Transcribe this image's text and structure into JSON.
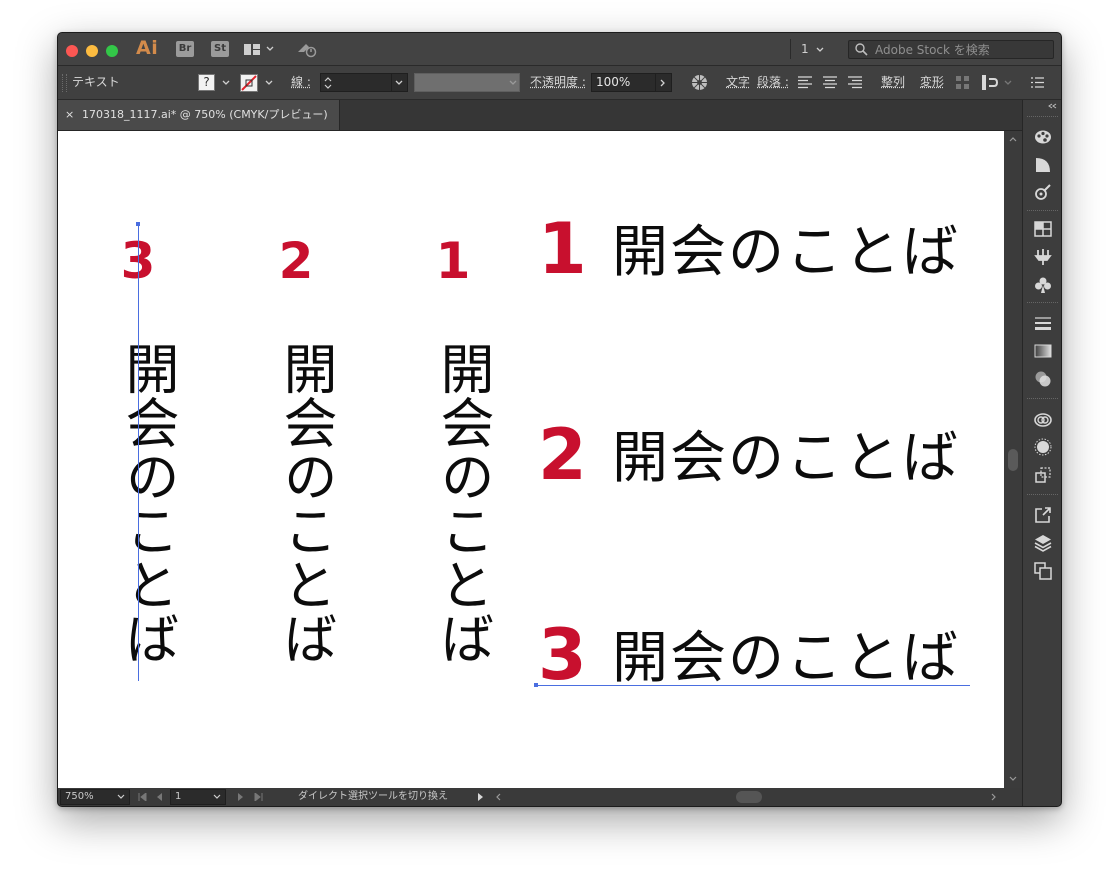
{
  "titlebar": {
    "app_logo": "Ai",
    "bridge_badge": "Br",
    "stock_badge": "St",
    "doc_number": "1",
    "search_placeholder": "Adobe Stock を検索"
  },
  "controlbar": {
    "tool_label": "テキスト",
    "fill_value": "?",
    "stroke_label": "線 :",
    "opacity_label": "不透明度 :",
    "opacity_value": "100%",
    "char_label": "文字",
    "para_label": "段落 :",
    "align_label": "整列",
    "transform_label": "変形"
  },
  "tab": {
    "close": "×",
    "title": "170318_1117.ai* @ 750% (CMYK/プレビュー)"
  },
  "statusbar": {
    "zoom": "750%",
    "page": "1",
    "tool_status": "ダイレクト選択ツールを切り換え"
  },
  "artwork": {
    "vertical_columns": [
      {
        "number": "3",
        "text": "開会のことば"
      },
      {
        "number": "2",
        "text": "開会のことば"
      },
      {
        "number": "1",
        "text": "開会のことば"
      }
    ],
    "horizontal_rows": [
      {
        "number": "1",
        "text": "開会のことば"
      },
      {
        "number": "2",
        "text": "開会のことば"
      },
      {
        "number": "3",
        "text": "開会のことば"
      }
    ],
    "accent_color": "#c8102e"
  },
  "panel_icons": [
    "color-guide-icon",
    "swatches-icon",
    "brushes-icon",
    "symbols-icon",
    "graphic-styles-icon",
    "club-symbol-icon",
    "stroke-icon",
    "gradient-icon",
    "transparency-icon",
    "cc-libraries-icon",
    "appearance-icon",
    "asset-export-icon",
    "export-icon",
    "layers-icon",
    "artboards-icon"
  ]
}
